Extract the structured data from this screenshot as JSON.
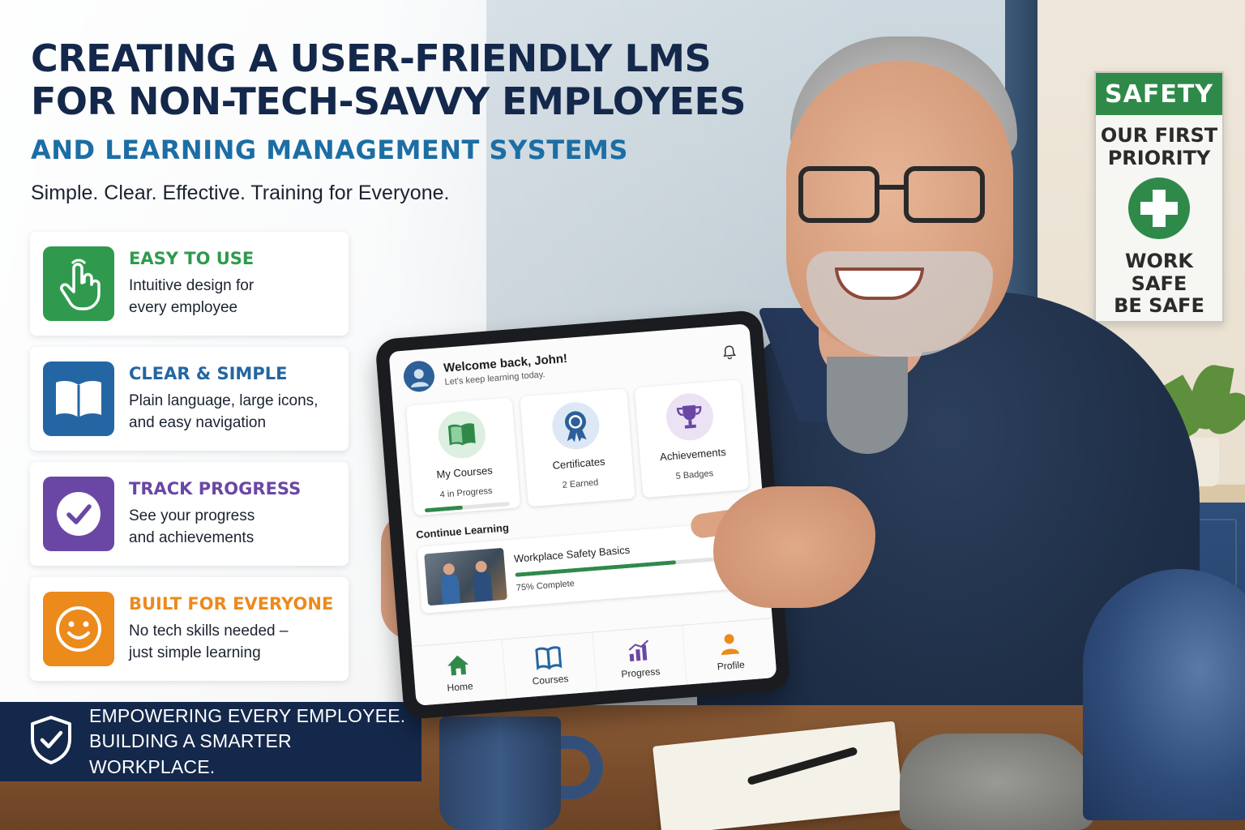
{
  "header": {
    "title_line1": "CREATING A USER-FRIENDLY LMS",
    "title_line2": "FOR NON-TECH-SAVVY EMPLOYEES",
    "subtitle": "AND LEARNING MANAGEMENT SYSTEMS",
    "tagline": "Simple. Clear. Effective. Training for Everyone."
  },
  "features": [
    {
      "title": "EASY TO USE",
      "line1": "Intuitive design for",
      "line2": "every employee",
      "color": "#2f9a4e",
      "icon": "tap-hand-icon"
    },
    {
      "title": "CLEAR & SIMPLE",
      "line1": "Plain language, large icons,",
      "line2": "and easy navigation",
      "color": "#2466a3",
      "icon": "open-book-icon"
    },
    {
      "title": "TRACK PROGRESS",
      "line1": "See your progress",
      "line2": "and achievements",
      "color": "#6a47a4",
      "icon": "check-circle-icon"
    },
    {
      "title": "BUILT FOR EVERYONE",
      "line1": "No tech skills needed –",
      "line2": "just simple learning",
      "color": "#ec8a1c",
      "icon": "smiley-icon"
    }
  ],
  "banner": {
    "line1": "EMPOWERING EVERY EMPLOYEE.",
    "line2": "BUILDING A SMARTER WORKPLACE."
  },
  "safety_sign": {
    "heading": "SAFETY",
    "line1": "OUR FIRST",
    "line2": "PRIORITY",
    "line3": "WORK SAFE",
    "line4": "BE SAFE"
  },
  "app": {
    "welcome": "Welcome back, John!",
    "welcome_sub": "Let's keep learning today.",
    "cards": [
      {
        "title": "My Courses",
        "sub": "4 in Progress",
        "progress": 0.45
      },
      {
        "title": "Certificates",
        "sub": "2 Earned"
      },
      {
        "title": "Achievements",
        "sub": "5 Badges"
      }
    ],
    "continue_label": "Continue Learning",
    "course": {
      "title": "Workplace Safety Basics",
      "sub": "75% Complete",
      "progress": 0.75
    },
    "nav": [
      "Home",
      "Courses",
      "Progress",
      "Profile"
    ]
  }
}
